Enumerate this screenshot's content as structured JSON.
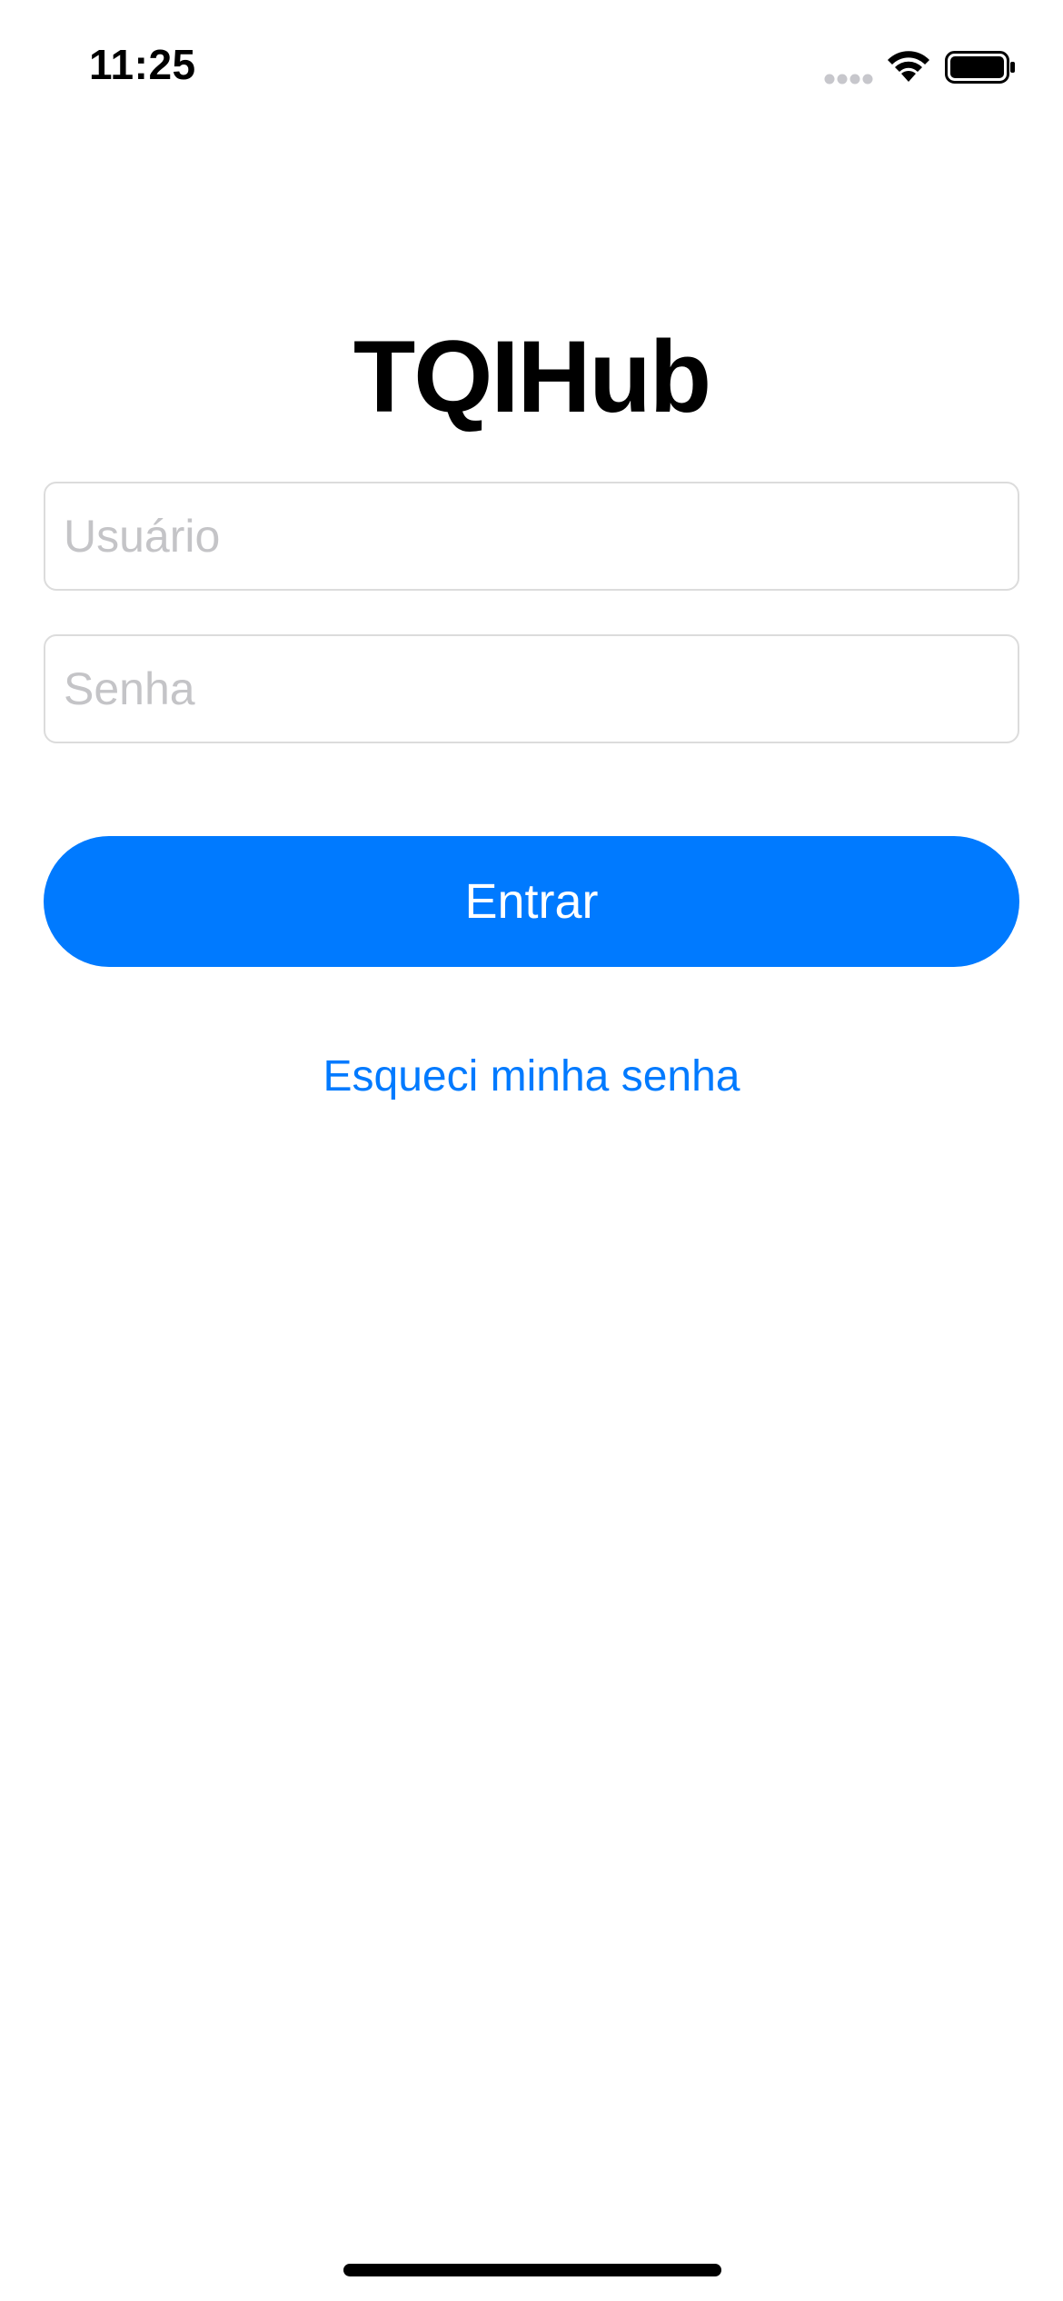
{
  "status_bar": {
    "time": "11:25",
    "icons": [
      "signal-icon",
      "wifi-icon",
      "battery-icon"
    ]
  },
  "app": {
    "title": "TQIHub"
  },
  "form": {
    "username_placeholder": "Usuário",
    "username_value": "",
    "password_placeholder": "Senha",
    "password_value": "",
    "login_label": "Entrar",
    "forgot_label": "Esqueci minha senha"
  },
  "colors": {
    "accent": "#007aff",
    "background": "#ffffff",
    "placeholder": "#c4c4c7",
    "field_border": "#dcdcdc"
  }
}
